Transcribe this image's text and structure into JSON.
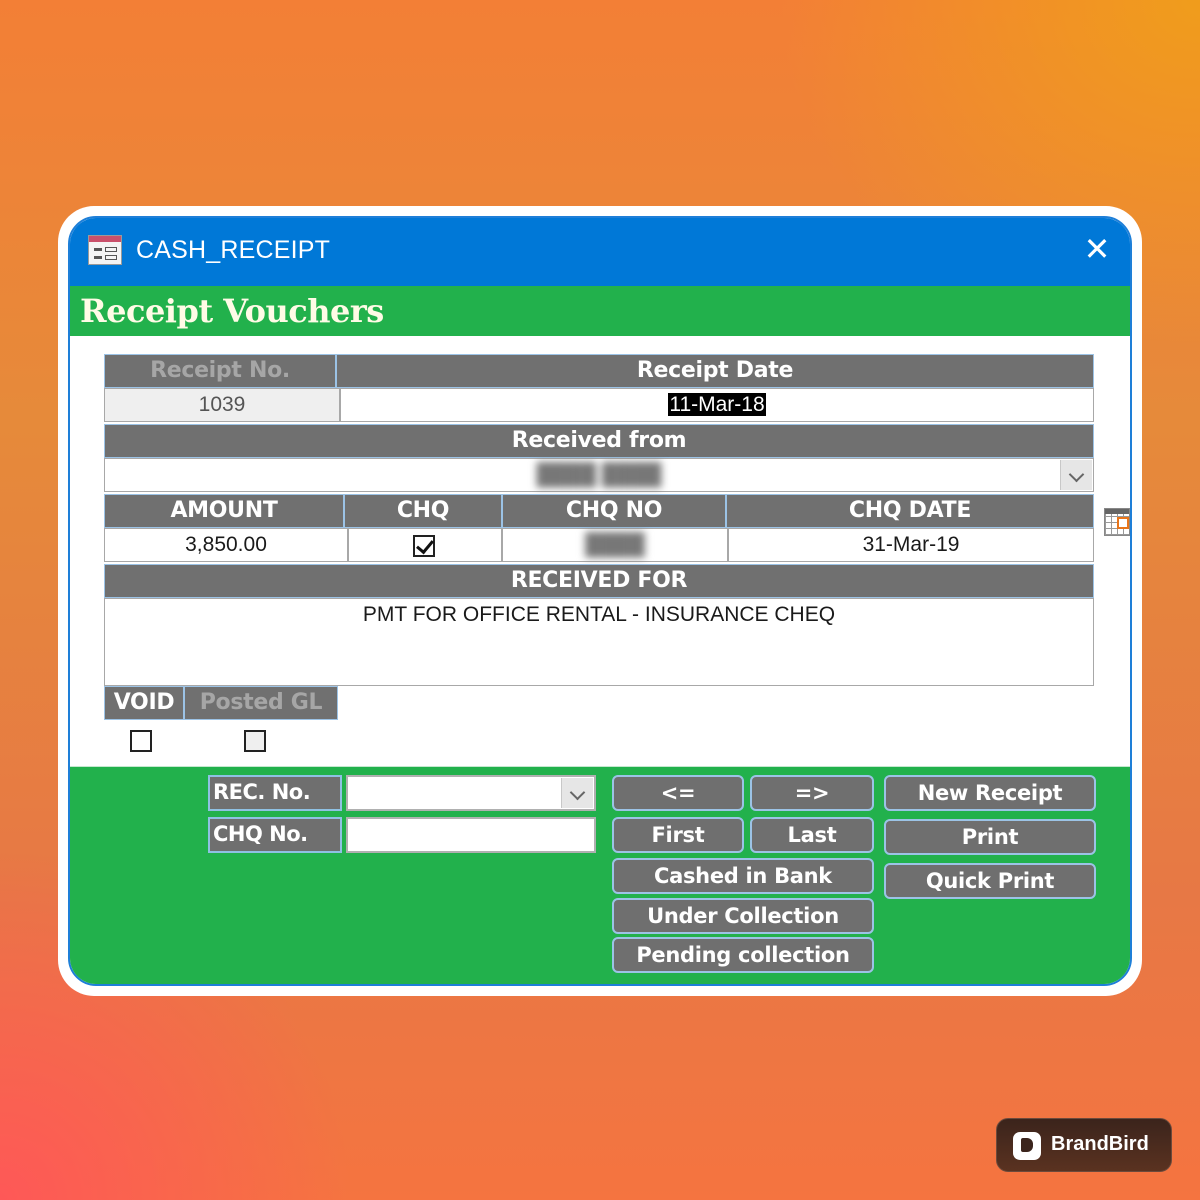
{
  "window": {
    "title": "CASH_RECEIPT",
    "heading": "Receipt Vouchers",
    "icon": "form-icon",
    "close_icon": "close-icon"
  },
  "form": {
    "receipt_no": {
      "label": "Receipt No.",
      "value": "1039"
    },
    "receipt_date": {
      "label": "Receipt Date",
      "value": "11-Mar-18",
      "picker_icon": "calendar-icon"
    },
    "received_from": {
      "label": "Received from",
      "value": "████ ████"
    },
    "amount": {
      "label": "AMOUNT",
      "value": "3,850.00"
    },
    "chq": {
      "label": "CHQ",
      "checked": true
    },
    "chq_no": {
      "label": "CHQ NO",
      "value": "████"
    },
    "chq_date": {
      "label": "CHQ DATE",
      "value": "31-Mar-19"
    },
    "received_for": {
      "label": "RECEIVED FOR",
      "value": "PMT FOR OFFICE RENTAL - INSURANCE CHEQ"
    },
    "void": {
      "label": "VOID",
      "checked": false
    },
    "posted_gl": {
      "label": "Posted GL",
      "checked": false
    }
  },
  "footer": {
    "rec_no": {
      "label": "REC. No.",
      "value": ""
    },
    "chq_no": {
      "label": "CHQ No.",
      "value": ""
    },
    "buttons": {
      "prev": "<=",
      "next": "=>",
      "first": "First",
      "last": "Last",
      "cashed_in_bank": "Cashed in Bank",
      "under_collection": "Under Collection",
      "pending_collection": "Pending collection",
      "new_receipt": "New Receipt",
      "print": "Print",
      "quick_print": "Quick Print"
    }
  },
  "watermark": {
    "brand": "BrandBird"
  },
  "colors": {
    "titlebar": "#0078d7",
    "header": "#22b14c",
    "label_bg": "#707070",
    "button_border": "#9cc3e6"
  }
}
